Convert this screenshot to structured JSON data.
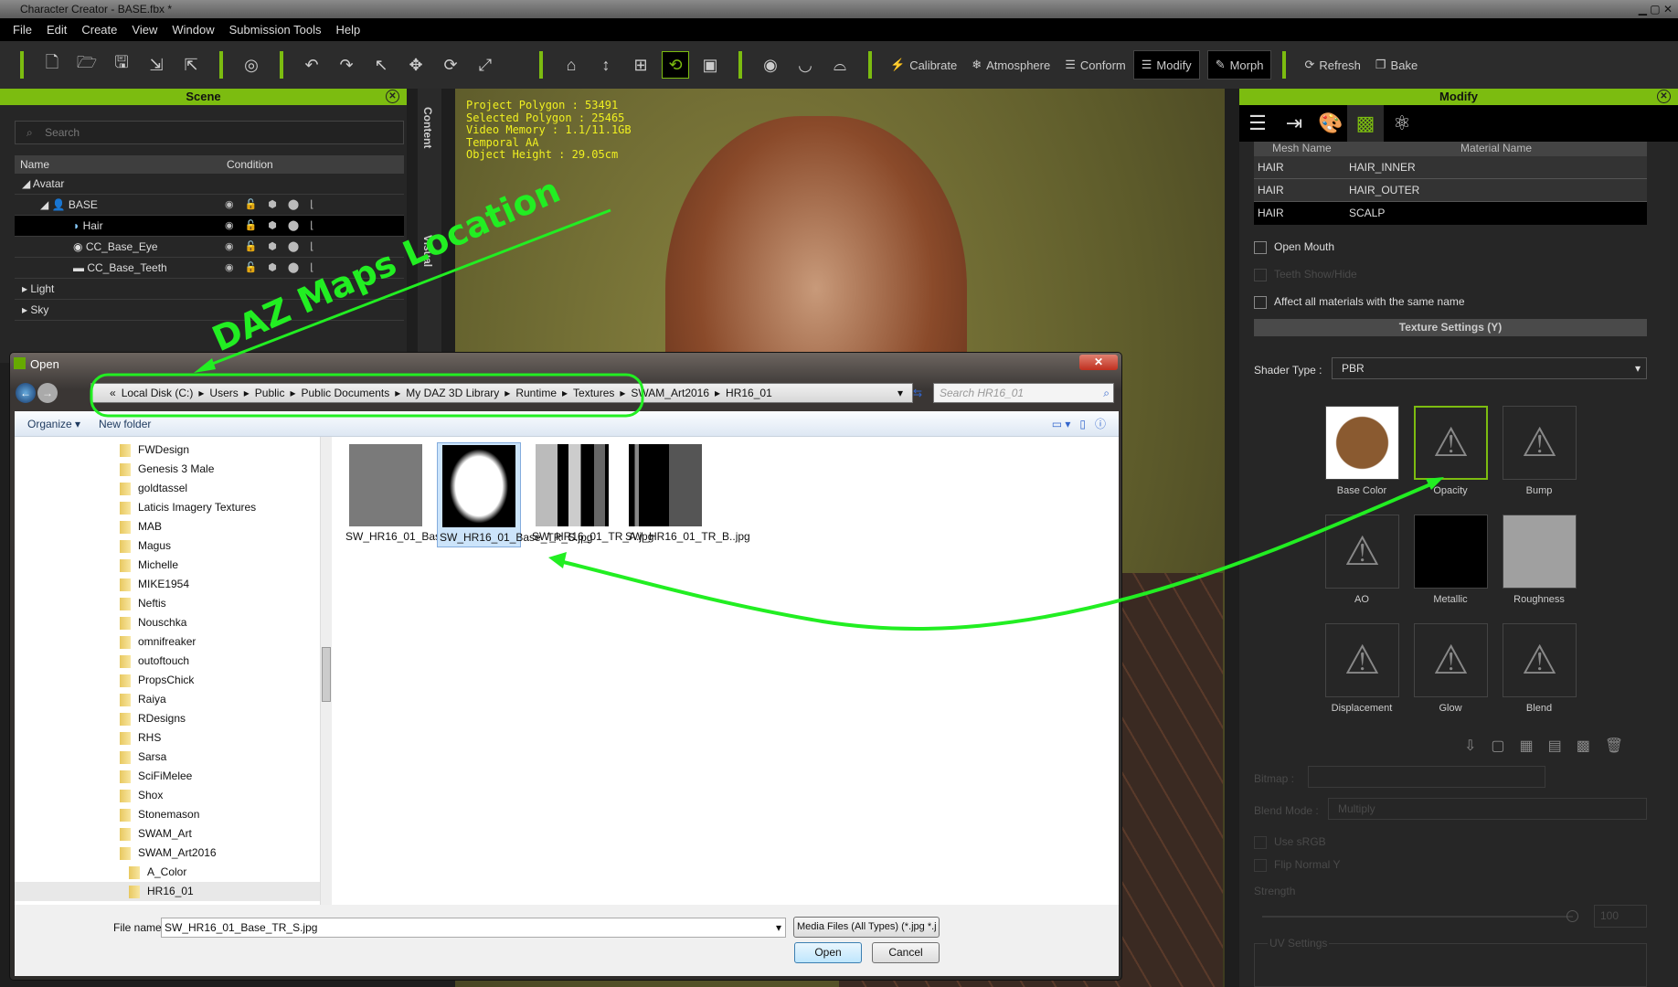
{
  "window": {
    "title": "Character Creator - BASE.fbx *"
  },
  "menu": [
    "File",
    "Edit",
    "Create",
    "View",
    "Window",
    "Submission Tools",
    "Help"
  ],
  "toolbar": {
    "calibrate": "Calibrate",
    "atmosphere": "Atmosphere",
    "conform": "Conform",
    "modify": "Modify",
    "morph": "Morph",
    "refresh": "Refresh",
    "bake": "Bake"
  },
  "scene": {
    "title": "Scene",
    "search_placeholder": "Search",
    "col_name": "Name",
    "col_condition": "Condition",
    "rows": [
      {
        "label": "Avatar"
      },
      {
        "label": "BASE"
      },
      {
        "label": "Hair"
      },
      {
        "label": "CC_Base_Eye"
      },
      {
        "label": "CC_Base_Teeth"
      },
      {
        "label": "Light"
      },
      {
        "label": "Sky"
      }
    ]
  },
  "side_tabs": [
    "Content",
    "Visual"
  ],
  "viewport": {
    "stats": [
      "Project Polygon : 53491",
      "Selected Polygon : 25465",
      "Video Memory : 1.1/11.1GB",
      "Temporal AA",
      "Object Height : 29.05cm"
    ]
  },
  "annotation": {
    "text": "DAZ Maps Location",
    "color": "#22ee22"
  },
  "modify": {
    "title": "Modify",
    "col_mesh": "Mesh Name",
    "col_material": "Material Name",
    "rows": [
      {
        "mesh": "HAIR",
        "material": "HAIR_INNER"
      },
      {
        "mesh": "HAIR",
        "material": "HAIR_OUTER"
      },
      {
        "mesh": "HAIR",
        "material": "SCALP"
      }
    ],
    "open_mouth": "Open Mouth",
    "teeth": "Teeth Show/Hide",
    "affect_all": "Affect all materials with the same name",
    "texture_settings": "Texture Settings  (Y)",
    "shader_label": "Shader Type :",
    "shader_value": "PBR",
    "channels": [
      "Base Color",
      "Opacity",
      "Bump",
      "AO",
      "Metallic",
      "Roughness",
      "Displacement",
      "Glow",
      "Blend"
    ],
    "bitmap_label": "Bitmap :",
    "blend_label": "Blend Mode :",
    "blend_value": "Multiply",
    "use_srgb": "Use sRGB",
    "flip_normal": "Flip Normal Y",
    "strength_label": "Strength",
    "strength_value": "100",
    "uv_settings": "UV Settings"
  },
  "dialog": {
    "title": "Open",
    "breadcrumb": [
      "Local Disk (C:)",
      "Users",
      "Public",
      "Public Documents",
      "My DAZ 3D Library",
      "Runtime",
      "Textures",
      "SWAM_Art2016",
      "HR16_01"
    ],
    "search_placeholder": "Search HR16_01",
    "organize": "Organize ▾",
    "new_folder": "New folder",
    "folders": [
      "FWDesign",
      "Genesis 3 Male",
      "goldtassel",
      "Laticis Imagery Textures",
      "MAB",
      "Magus",
      "Michelle",
      "MIKE1954",
      "Neftis",
      "Nouschka",
      "omnifreaker",
      "outoftouch",
      "PropsChick",
      "Raiya",
      "RDesigns",
      "RHS",
      "Sarsa",
      "SciFiMelee",
      "Shox",
      "Stonemason",
      "SWAM_Art",
      "SWAM_Art2016",
      "A_Color",
      "HR16_01"
    ],
    "files": [
      "SW_HR16_01_Base_BUM.jpg",
      "SW_HR16_01_Base_TR_S.jpg",
      "SW_HR16_01_TR_A.jpg",
      "SW_HR16_01_TR_B..jpg"
    ],
    "filename_label": "File name:",
    "filename_value": "SW_HR16_01_Base_TR_S.jpg",
    "filter": "Media Files (All Types) (*.jpg *.j",
    "open": "Open",
    "cancel": "Cancel"
  },
  "colors": {
    "accent": "#7cbc10",
    "annotation": "#22ee22"
  }
}
